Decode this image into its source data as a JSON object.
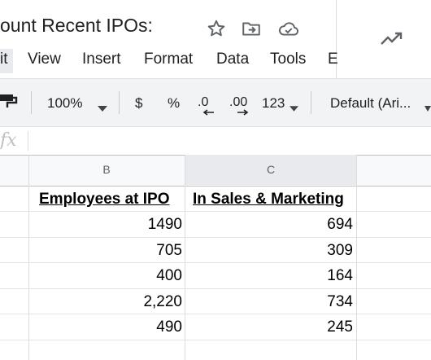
{
  "doc": {
    "title": "ount Recent IPOs:"
  },
  "icons": {
    "star": "star-icon",
    "folder": "move-folder-icon",
    "cloud": "cloud-saved-icon",
    "trend": "trending-up-icon"
  },
  "menu": [
    "it",
    "View",
    "Insert",
    "Format",
    "Data",
    "Tools",
    "E"
  ],
  "toolbar": {
    "zoom": "100%",
    "currency": "$",
    "percent": "%",
    "decrease_decimal": ".0",
    "increase_decimal": ".00",
    "more_formats": "123",
    "font": "Default (Ari..."
  },
  "formula": {
    "fx": "fx"
  },
  "columns": [
    {
      "letter": "B"
    },
    {
      "letter": "C"
    }
  ],
  "table": {
    "headers": [
      "Employees at IPO",
      "In Sales & Marketing"
    ],
    "rows": [
      [
        "1490",
        "694"
      ],
      [
        "705",
        "309"
      ],
      [
        "400",
        "164"
      ],
      [
        "2,220",
        "734"
      ],
      [
        "490",
        "245"
      ]
    ]
  }
}
